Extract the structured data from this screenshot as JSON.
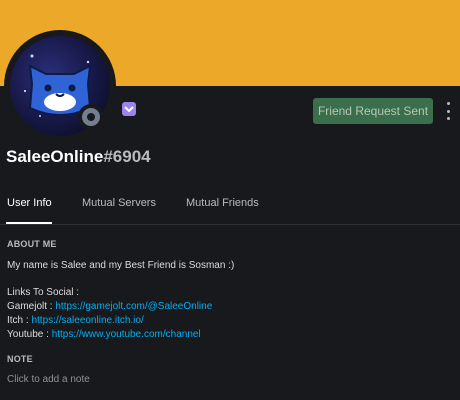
{
  "colors": {
    "banner": "#eba829",
    "background": "#18191c",
    "button": "#3b6e4a",
    "link": "#00aff4",
    "status_offline": "#747f8d",
    "nitro_badge": "#9b84ec"
  },
  "profile": {
    "username": "SaleeOnline",
    "discriminator": "#6904",
    "status": "offline",
    "badge_icon": "nitro-badge-icon",
    "avatar_icon": "blue-cat-avatar"
  },
  "actions": {
    "friend_request_label": "Friend Request Sent",
    "more_icon": "more-vertical-icon"
  },
  "tabs": [
    {
      "label": "User Info",
      "active": true
    },
    {
      "label": "Mutual Servers",
      "active": false
    },
    {
      "label": "Mutual Friends",
      "active": false
    }
  ],
  "about": {
    "title": "ABOUT ME",
    "intro": "My name is Salee and my Best Friend is Sosman :)",
    "links_heading": "Links To Social :",
    "links": [
      {
        "label": "Gamejolt : ",
        "url": "https://gamejolt.com/@SaleeOnline"
      },
      {
        "label": "Itch : ",
        "url": "https://saleeonline.itch.io/"
      },
      {
        "label": "Youtube : ",
        "url": "https://www.youtube.com/channel"
      }
    ]
  },
  "note": {
    "title": "NOTE",
    "placeholder": "Click to add a note"
  }
}
